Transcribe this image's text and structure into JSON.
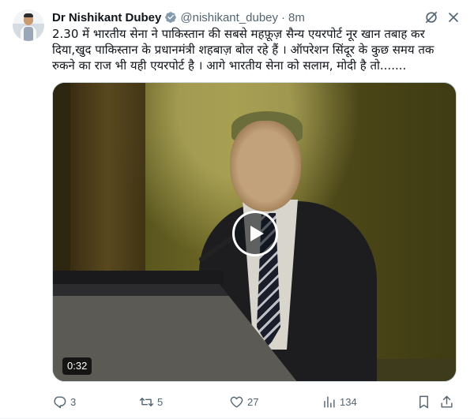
{
  "author": {
    "display_name": "Dr Nishikant Dubey",
    "handle": "@nishikant_dubey",
    "separator": "·",
    "time_ago": "8m",
    "verified_icon": "verified-badge-icon"
  },
  "tweet": {
    "text": "2.30 में भारतीय सेना ने पाकिस्तान की सबसे महफ़ूज़ सैन्य एयरपोर्ट नूर खान तबाह कर दिया,खुद पाकिस्तान के प्रधानमंत्री शहबाज़ बोल रहे हैं । ऑपरेशन सिंदूर के कुछ समय तक रुकने का राज भी यही एयरपोर्ट है । आगे भारतीय सेना को सलाम, मोदी है तो......."
  },
  "media": {
    "type": "video",
    "duration": "0:32",
    "play_icon": "play-icon"
  },
  "actions": {
    "reply_count": "3",
    "retweet_count": "5",
    "like_count": "27",
    "views_count": "134"
  },
  "colors": {
    "text_primary": "#0f1419",
    "text_secondary": "#536471",
    "verified_badge": "#829aab",
    "border": "#cfd9de"
  }
}
